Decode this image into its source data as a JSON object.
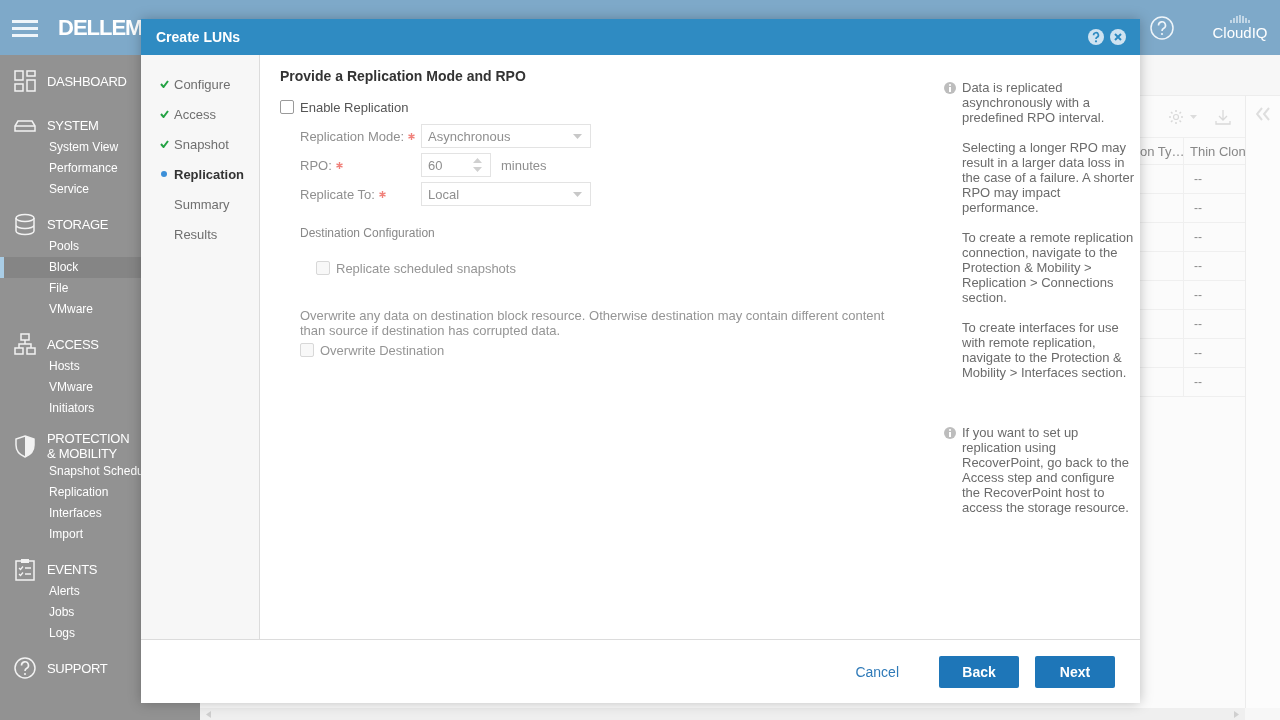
{
  "top_bar": {
    "logo": "DELLEM",
    "cloud_label": "CloudIQ"
  },
  "sidebar": {
    "sections": [
      {
        "kind": "dashboard",
        "label": "DASHBOARD"
      },
      {
        "kind": "system",
        "label": "SYSTEM",
        "items": [
          {
            "label": "System View",
            "selected": false
          },
          {
            "label": "Performance",
            "selected": false
          },
          {
            "label": "Service",
            "selected": false
          }
        ]
      },
      {
        "kind": "storage",
        "label": "STORAGE",
        "items": [
          {
            "label": "Pools",
            "selected": false
          },
          {
            "label": "Block",
            "selected": true
          },
          {
            "label": "File",
            "selected": false
          },
          {
            "label": "VMware",
            "selected": false
          }
        ]
      },
      {
        "kind": "access",
        "label": "ACCESS",
        "items": [
          {
            "label": "Hosts",
            "selected": false
          },
          {
            "label": "VMware",
            "selected": false
          },
          {
            "label": "Initiators",
            "selected": false
          }
        ]
      },
      {
        "kind": "protection",
        "label": "PROTECTION & MOBILITY",
        "items": [
          {
            "label": "Snapshot Schedu",
            "selected": false
          },
          {
            "label": "Replication",
            "selected": false
          },
          {
            "label": "Interfaces",
            "selected": false
          },
          {
            "label": "Import",
            "selected": false
          }
        ]
      },
      {
        "kind": "events",
        "label": "EVENTS",
        "items": [
          {
            "label": "Alerts",
            "selected": false
          },
          {
            "label": "Jobs",
            "selected": false
          },
          {
            "label": "Logs",
            "selected": false
          }
        ]
      },
      {
        "kind": "support",
        "label": "SUPPORT"
      }
    ]
  },
  "table": {
    "columns": [
      "on Ty…",
      "Thin Clon"
    ],
    "rows": [
      {
        "column_2": "--"
      },
      {
        "column_2": "--"
      },
      {
        "column_2": "--"
      },
      {
        "column_2": "--"
      },
      {
        "column_2": "--"
      },
      {
        "column_2": "--"
      },
      {
        "column_2": "--"
      },
      {
        "column_2": "--"
      }
    ]
  },
  "dialog": {
    "title": "Create LUNs",
    "steps": [
      {
        "label": "Configure",
        "completed": true,
        "selected": false
      },
      {
        "label": "Access",
        "completed": true,
        "selected": false
      },
      {
        "label": "Snapshot",
        "completed": true,
        "selected": false
      },
      {
        "label": "Replication",
        "completed": false,
        "selected": true
      },
      {
        "label": "Summary",
        "completed": false,
        "selected": false
      },
      {
        "label": "Results",
        "completed": false,
        "selected": false
      }
    ],
    "heading": "Provide a Replication Mode and RPO",
    "enable_replication": {
      "label": "Enable Replication",
      "checked": false
    },
    "fields": [
      {
        "kind": "select",
        "label": "Replication Mode:",
        "required": true,
        "value": "Asynchronous",
        "disabled": true
      },
      {
        "kind": "spin",
        "label": "RPO:",
        "required": true,
        "value": "60",
        "unit": "minutes",
        "disabled": true
      },
      {
        "kind": "select",
        "label": "Replicate To:",
        "required": true,
        "value": "Local",
        "disabled": true
      }
    ],
    "destination_heading": "Destination Configuration",
    "snapshots_option": {
      "label": "Replicate scheduled snapshots",
      "checked": false,
      "disabled": true
    },
    "overwrite_note": "Overwrite any data on destination block resource. Otherwise destination may contain different content than source if destination has corrupted data.",
    "overwrite_option": {
      "label": "Overwrite Destination",
      "checked": false,
      "disabled": true
    },
    "info": [
      {
        "paragraphs": [
          "Data is replicated asynchronously with a predefined RPO interval.",
          "Selecting a longer RPO may result in a larger data loss in the case of a failure. A shorter RPO may impact performance.",
          "To create a remote replication connection, navigate to the Protection & Mobility > Replication > Connections section.",
          "To create interfaces for use with remote replication, navigate to the Protection & Mobility > Interfaces section."
        ]
      },
      {
        "paragraphs": [
          "If you want to set up replication using RecoverPoint, go back to the Access step and configure the RecoverPoint host to access the storage resource."
        ]
      }
    ],
    "buttons": [
      {
        "kind": "link",
        "label": "Cancel"
      },
      {
        "kind": "primary",
        "label": "Back"
      },
      {
        "kind": "primary",
        "label": "Next"
      }
    ]
  }
}
